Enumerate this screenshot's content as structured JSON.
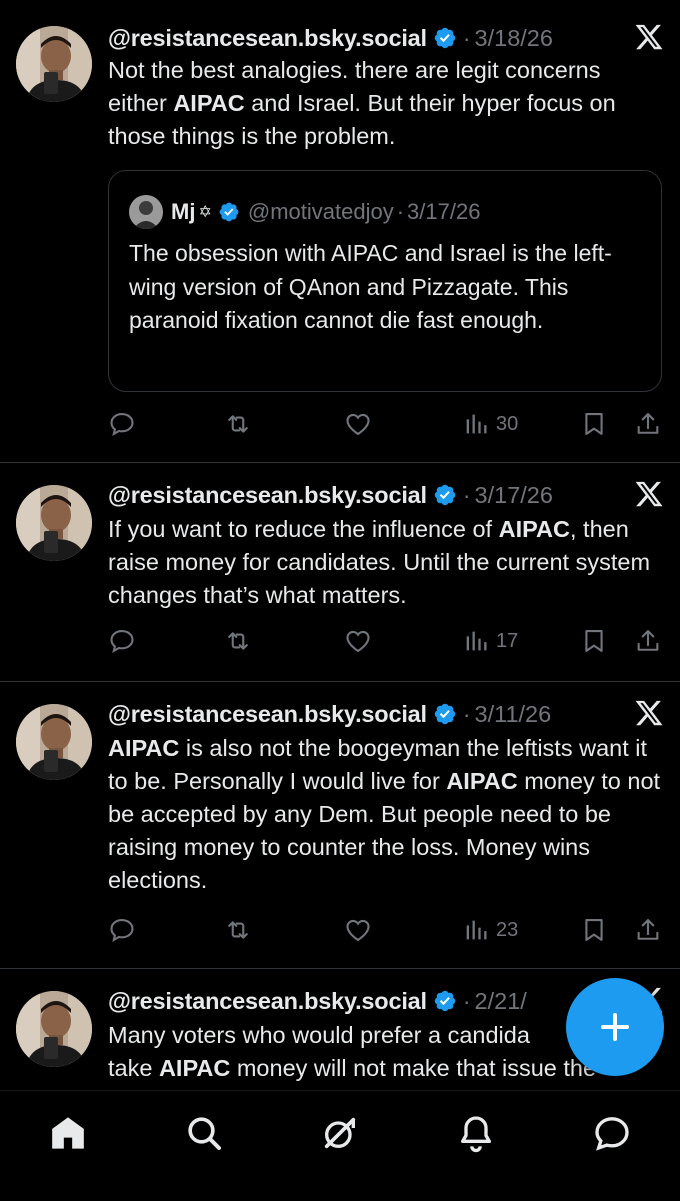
{
  "colors": {
    "background": "#000000",
    "text": "#e7e9ea",
    "muted": "#71767b",
    "accent": "#1d9bf0",
    "divider": "#2f3336"
  },
  "posts": [
    {
      "handle": "@resistancesean.bsky.social",
      "dot": "·",
      "date": "3/18/26",
      "text_parts": [
        "Not the best analogies. there are legit concerns either ",
        "AIPAC",
        " and Israel. But their hyper focus on those things is the problem."
      ],
      "quote": {
        "name": "Mj",
        "star": "✡",
        "handle": "@motivatedjoy",
        "dot": "·",
        "date": "3/17/26",
        "text": "The obsession with AIPAC and Israel is the left-wing version of QAnon and Pizzagate. This paranoid fixation cannot die fast enough."
      },
      "views": "30"
    },
    {
      "handle": "@resistancesean.bsky.social",
      "dot": "·",
      "date": "3/17/26",
      "text_parts": [
        "If you want to reduce the influence of ",
        "AIPAC",
        ", then raise money for candidates. Until the current system changes that’s what matters."
      ],
      "views": "17"
    },
    {
      "handle": "@resistancesean.bsky.social",
      "dot": "·",
      "date": "3/11/26",
      "text_parts": [
        "AIPAC",
        " is also not the boogeyman the leftists want it to be. Personally I would live for ",
        "AIPAC",
        " money to not be accepted by any Dem. But people need to be raising money to counter the loss. Money wins elections."
      ],
      "views": "23"
    },
    {
      "handle": "@resistancesean.bsky.social",
      "dot": "·",
      "date": "2/21/",
      "text_parts": [
        "Many voters who would prefer a candida",
        "",
        "",
        "take ",
        "AIPAC",
        " money will not make that issue the"
      ]
    }
  ],
  "icons": {
    "post_source": "x-logo-icon",
    "verified": "verified-badge-icon",
    "actions": [
      "reply-icon",
      "repost-icon",
      "like-icon",
      "views-icon",
      "bookmark-icon",
      "share-icon"
    ],
    "fab": "plus-icon",
    "nav": [
      "home-icon",
      "search-icon",
      "grok-icon",
      "notifications-icon",
      "messages-icon"
    ]
  }
}
